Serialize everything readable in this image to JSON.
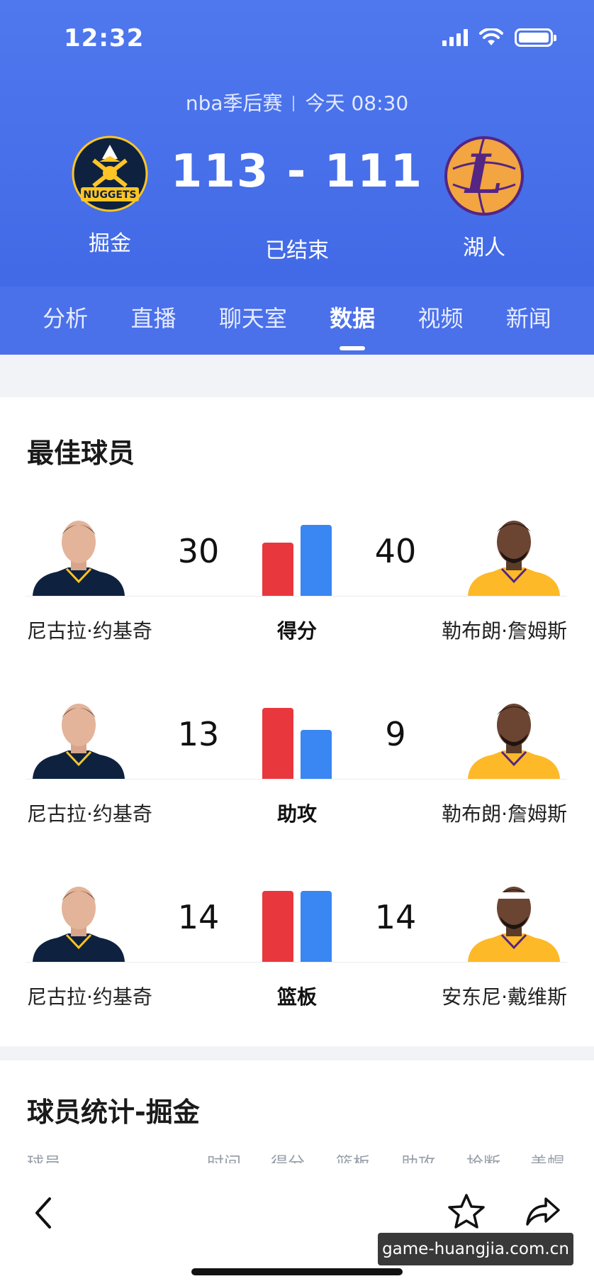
{
  "status_bar": {
    "time": "12:32"
  },
  "game": {
    "league": "nba季后赛",
    "datetime": "今天 08:30",
    "home_team": "掘金",
    "away_team": "湖人",
    "score": "113 - 111",
    "status": "已结束"
  },
  "tabs": [
    {
      "label": "分析",
      "active": false
    },
    {
      "label": "直播",
      "active": false
    },
    {
      "label": "聊天室",
      "active": false
    },
    {
      "label": "数据",
      "active": true
    },
    {
      "label": "视频",
      "active": false
    },
    {
      "label": "新闻",
      "active": false
    }
  ],
  "best_players": {
    "title": "最佳球员",
    "rows": [
      {
        "label": "得分",
        "left_player": "尼古拉·约基奇",
        "left_value": 30,
        "right_player": "勒布朗·詹姆斯",
        "right_value": 40
      },
      {
        "label": "助攻",
        "left_player": "尼古拉·约基奇",
        "left_value": 13,
        "right_player": "勒布朗·詹姆斯",
        "right_value": 9
      },
      {
        "label": "篮板",
        "left_player": "尼古拉·约基奇",
        "left_value": 14,
        "right_player": "安东尼·戴维斯",
        "right_value": 14
      }
    ]
  },
  "player_stats": {
    "title": "球员统计-掘金",
    "columns": [
      "球员",
      "时间",
      "得分",
      "篮板",
      "助攻",
      "抢断",
      "盖帽"
    ]
  },
  "watermark": "game-huangjia.com.cn",
  "colors": {
    "header_blue": "#4a70ea",
    "home_bar": "#e8373d",
    "away_bar": "#3a86f2"
  }
}
